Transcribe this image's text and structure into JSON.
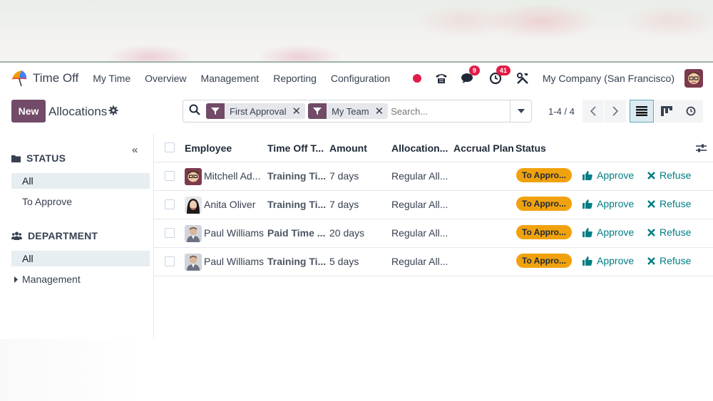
{
  "navbar": {
    "app_name": "Time Off",
    "menu": [
      "My Time",
      "Overview",
      "Management",
      "Reporting",
      "Configuration"
    ],
    "messages_badge": "9",
    "activities_badge": "41",
    "company": "My Company (San Francisco)",
    "icons": [
      "phone-icon",
      "chat-icon",
      "clock-icon",
      "tools-icon"
    ]
  },
  "control": {
    "new_label": "New",
    "title": "Allocations",
    "search": {
      "facets": [
        "First Approval",
        "My Team"
      ],
      "placeholder": "Search..."
    },
    "pager": "1-4 / 4"
  },
  "sidebar": {
    "status": {
      "heading": "STATUS",
      "items": [
        "All",
        "To Approve"
      ]
    },
    "department": {
      "heading": "DEPARTMENT",
      "items": [
        "All",
        "Management"
      ]
    }
  },
  "table": {
    "columns": [
      "Employee",
      "Time Off T...",
      "Amount",
      "Allocation...",
      "Accrual Plan",
      "Status"
    ],
    "rows": [
      {
        "employee": "Mitchell Ad...",
        "type": "Training Ti...",
        "amount": "7 days",
        "allocation": "Regular All...",
        "accrual": "",
        "status": "To Appro..."
      },
      {
        "employee": "Anita Oliver",
        "type": "Training Ti...",
        "amount": "7 days",
        "allocation": "Regular All...",
        "accrual": "",
        "status": "To Appro..."
      },
      {
        "employee": "Paul Williams",
        "type": "Paid Time ...",
        "amount": "20 days",
        "allocation": "Regular All...",
        "accrual": "",
        "status": "To Appro..."
      },
      {
        "employee": "Paul Williams",
        "type": "Training Ti...",
        "amount": "5 days",
        "allocation": "Regular All...",
        "accrual": "",
        "status": "To Appro..."
      }
    ],
    "approve_label": "Approve",
    "refuse_label": "Refuse"
  },
  "colors": {
    "brand": "#714b67",
    "action": "#017e84",
    "status_badge": "#f0a20e",
    "notification": "#e11d48"
  }
}
